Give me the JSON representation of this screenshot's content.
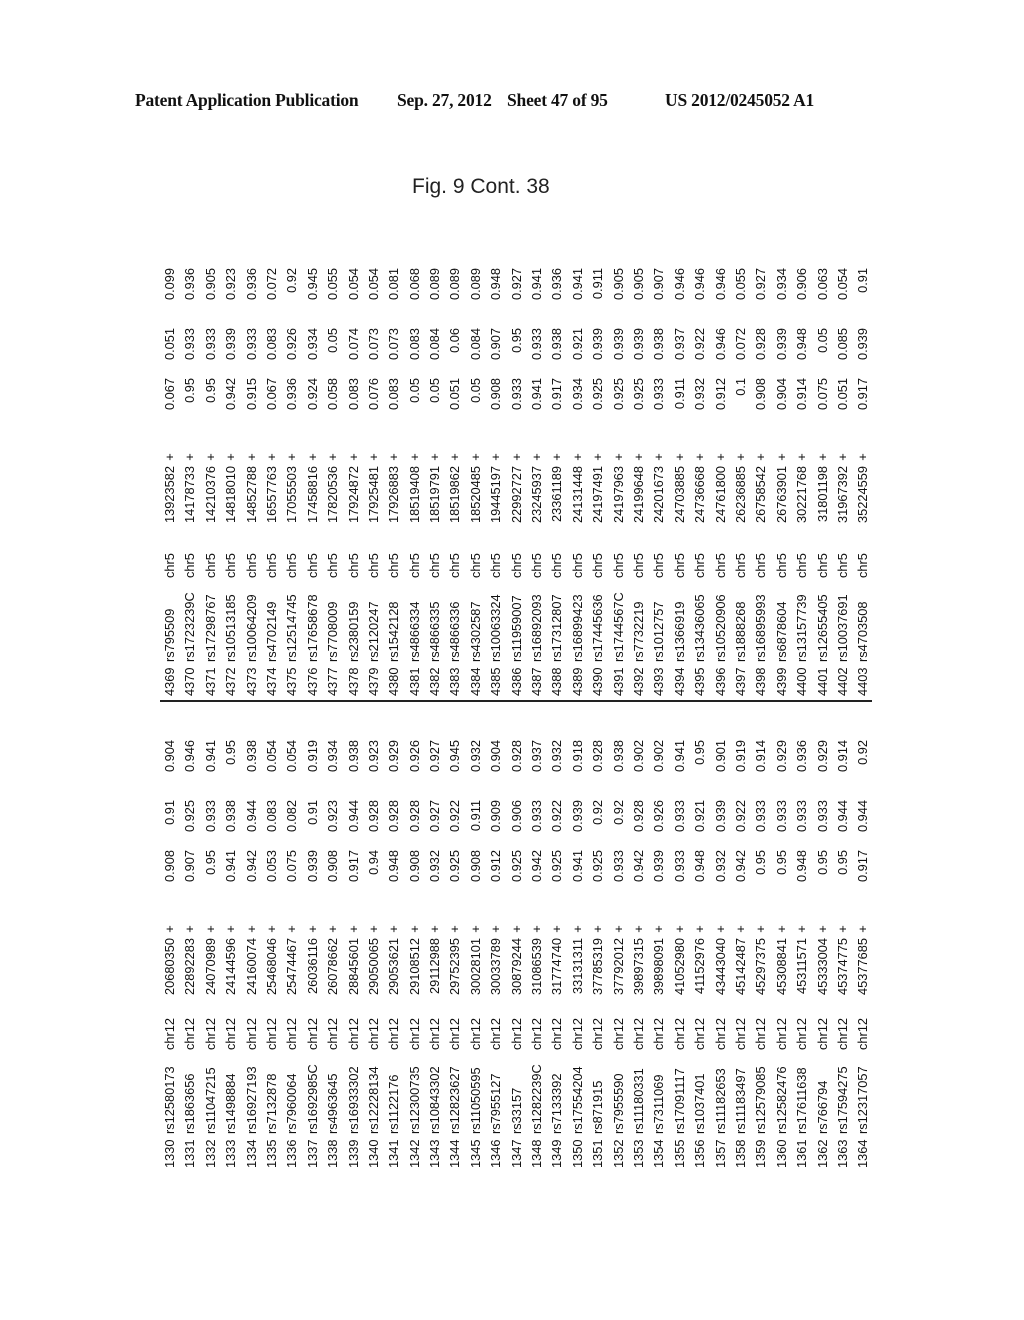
{
  "header": {
    "publication": "Patent Application Publication",
    "date": "Sep. 27, 2012",
    "sheet": "Sheet 47 of 95",
    "number": "US 2012/0245052 A1"
  },
  "figure_label": "Fig. 9   Cont. 38",
  "table_left": [
    [
      "1330",
      "rs12580173",
      "chr12",
      "20680350",
      "+",
      "0.908",
      "0.91",
      "0.904"
    ],
    [
      "1331",
      "rs1863656",
      "chr12",
      "22892283",
      "+",
      "0.907",
      "0.925",
      "0.946"
    ],
    [
      "1332",
      "rs11047215",
      "chr12",
      "24070989",
      "+",
      "0.95",
      "0.933",
      "0.941"
    ],
    [
      "1333",
      "rs1498884",
      "chr12",
      "24144596",
      "+",
      "0.941",
      "0.938",
      "0.95"
    ],
    [
      "1334",
      "rs16927193",
      "chr12",
      "24160074",
      "+",
      "0.942",
      "0.944",
      "0.938"
    ],
    [
      "1335",
      "rs7132878",
      "chr12",
      "25468046",
      "+",
      "0.053",
      "0.083",
      "0.054"
    ],
    [
      "1336",
      "rs7960064",
      "chr12",
      "25474467",
      "+",
      "0.075",
      "0.082",
      "0.054"
    ],
    [
      "1337",
      "rs1692985C",
      "chr12",
      "26036116",
      "+",
      "0.939",
      "0.91",
      "0.919"
    ],
    [
      "1338",
      "rs4963645",
      "chr12",
      "26078662",
      "+",
      "0.908",
      "0.923",
      "0.934"
    ],
    [
      "1339",
      "rs16933302",
      "chr12",
      "28845601",
      "+",
      "0.917",
      "0.944",
      "0.938"
    ],
    [
      "1340",
      "rs12228134",
      "chr12",
      "29050065",
      "+",
      "0.94",
      "0.928",
      "0.923"
    ],
    [
      "1341",
      "rs1122176",
      "chr12",
      "29053621",
      "+",
      "0.948",
      "0.928",
      "0.929"
    ],
    [
      "1342",
      "rs12300735",
      "chr12",
      "29108512",
      "+",
      "0.908",
      "0.928",
      "0.926"
    ],
    [
      "1343",
      "rs10843302",
      "chr12",
      "29112988",
      "+",
      "0.932",
      "0.927",
      "0.927"
    ],
    [
      "1344",
      "rs12823627",
      "chr12",
      "29752395",
      "+",
      "0.925",
      "0.922",
      "0.945"
    ],
    [
      "1345",
      "rs11050595",
      "chr12",
      "30028101",
      "+",
      "0.908",
      "0.911",
      "0.932"
    ],
    [
      "1346",
      "rs7955127",
      "chr12",
      "30033789",
      "+",
      "0.912",
      "0.909",
      "0.904"
    ],
    [
      "1347",
      "rs33157",
      "chr12",
      "30879244",
      "+",
      "0.925",
      "0.906",
      "0.928"
    ],
    [
      "1348",
      "rs1282239C",
      "chr12",
      "31086539",
      "+",
      "0.942",
      "0.933",
      "0.937"
    ],
    [
      "1349",
      "rs7133392",
      "chr12",
      "31774740",
      "+",
      "0.925",
      "0.922",
      "0.932"
    ],
    [
      "1350",
      "rs17554204",
      "chr12",
      "33131311",
      "+",
      "0.941",
      "0.939",
      "0.918"
    ],
    [
      "1351",
      "rs871915",
      "chr12",
      "37785319",
      "+",
      "0.925",
      "0.92",
      "0.928"
    ],
    [
      "1352",
      "rs7955590",
      "chr12",
      "37792012",
      "+",
      "0.933",
      "0.92",
      "0.938"
    ],
    [
      "1353",
      "rs11180331",
      "chr12",
      "39897315",
      "+",
      "0.942",
      "0.928",
      "0.902"
    ],
    [
      "1354",
      "rs7311069",
      "chr12",
      "39898091",
      "+",
      "0.939",
      "0.926",
      "0.902"
    ],
    [
      "1355",
      "rs17091117",
      "chr12",
      "41052980",
      "+",
      "0.933",
      "0.933",
      "0.941"
    ],
    [
      "1356",
      "rs1037401",
      "chr12",
      "41152976",
      "+",
      "0.948",
      "0.921",
      "0.95"
    ],
    [
      "1357",
      "rs11182653",
      "chr12",
      "43443040",
      "+",
      "0.932",
      "0.939",
      "0.901"
    ],
    [
      "1358",
      "rs11183497",
      "chr12",
      "45142487",
      "+",
      "0.942",
      "0.922",
      "0.919"
    ],
    [
      "1359",
      "rs12579085",
      "chr12",
      "45297375",
      "+",
      "0.95",
      "0.933",
      "0.914"
    ],
    [
      "1360",
      "rs12582476",
      "chr12",
      "45308841",
      "+",
      "0.95",
      "0.933",
      "0.929"
    ],
    [
      "1361",
      "rs17611638",
      "chr12",
      "45311571",
      "+",
      "0.948",
      "0.933",
      "0.936"
    ],
    [
      "1362",
      "rs766794",
      "chr12",
      "45333004",
      "+",
      "0.95",
      "0.933",
      "0.929"
    ],
    [
      "1363",
      "rs17594275",
      "chr12",
      "45374775",
      "+",
      "0.95",
      "0.944",
      "0.914"
    ],
    [
      "1364",
      "rs12317057",
      "chr12",
      "45377685",
      "+",
      "0.917",
      "0.944",
      "0.92"
    ]
  ],
  "table_right": [
    [
      "4369",
      "rs795509",
      "chr5",
      "13923582",
      "+",
      "0.067",
      "0.051",
      "0.099"
    ],
    [
      "4370",
      "rs1723239C",
      "chr5",
      "14178733",
      "+",
      "0.95",
      "0.933",
      "0.936"
    ],
    [
      "4371",
      "rs17298767",
      "chr5",
      "14210376",
      "+",
      "0.95",
      "0.933",
      "0.905"
    ],
    [
      "4372",
      "rs10513185",
      "chr5",
      "14818010",
      "+",
      "0.942",
      "0.939",
      "0.923"
    ],
    [
      "4373",
      "rs10064209",
      "chr5",
      "14852788",
      "+",
      "0.915",
      "0.933",
      "0.936"
    ],
    [
      "4374",
      "rs4702149",
      "chr5",
      "16557763",
      "+",
      "0.067",
      "0.083",
      "0.072"
    ],
    [
      "4375",
      "rs12514745",
      "chr5",
      "17055503",
      "+",
      "0.936",
      "0.926",
      "0.92"
    ],
    [
      "4376",
      "rs17658678",
      "chr5",
      "17458816",
      "+",
      "0.924",
      "0.934",
      "0.945"
    ],
    [
      "4377",
      "rs7708009",
      "chr5",
      "17820536",
      "+",
      "0.058",
      "0.05",
      "0.055"
    ],
    [
      "4378",
      "rs2380159",
      "chr5",
      "17924872",
      "+",
      "0.083",
      "0.074",
      "0.054"
    ],
    [
      "4379",
      "rs2120247",
      "chr5",
      "17925481",
      "+",
      "0.076",
      "0.073",
      "0.054"
    ],
    [
      "4380",
      "rs1542128",
      "chr5",
      "17926883",
      "+",
      "0.083",
      "0.073",
      "0.081"
    ],
    [
      "4381",
      "rs4866334",
      "chr5",
      "18519408",
      "+",
      "0.05",
      "0.083",
      "0.068"
    ],
    [
      "4382",
      "rs4866335",
      "chr5",
      "18519791",
      "+",
      "0.05",
      "0.084",
      "0.089"
    ],
    [
      "4383",
      "rs4866336",
      "chr5",
      "18519862",
      "+",
      "0.051",
      "0.06",
      "0.089"
    ],
    [
      "4384",
      "rs4302587",
      "chr5",
      "18520485",
      "+",
      "0.05",
      "0.084",
      "0.089"
    ],
    [
      "4385",
      "rs10063324",
      "chr5",
      "19445197",
      "+",
      "0.908",
      "0.907",
      "0.948"
    ],
    [
      "4386",
      "rs11959007",
      "chr5",
      "22992727",
      "+",
      "0.933",
      "0.95",
      "0.927"
    ],
    [
      "4387",
      "rs16892093",
      "chr5",
      "23245937",
      "+",
      "0.941",
      "0.933",
      "0.941"
    ],
    [
      "4388",
      "rs17312807",
      "chr5",
      "23361189",
      "+",
      "0.917",
      "0.938",
      "0.936"
    ],
    [
      "4389",
      "rs16899423",
      "chr5",
      "24131448",
      "+",
      "0.934",
      "0.921",
      "0.941"
    ],
    [
      "4390",
      "rs17445636",
      "chr5",
      "24197491",
      "+",
      "0.925",
      "0.939",
      "0.911"
    ],
    [
      "4391",
      "rs1744567C",
      "chr5",
      "24197963",
      "+",
      "0.925",
      "0.939",
      "0.905"
    ],
    [
      "4392",
      "rs7732219",
      "chr5",
      "24199648",
      "+",
      "0.925",
      "0.939",
      "0.905"
    ],
    [
      "4393",
      "rs1012757",
      "chr5",
      "24201673",
      "+",
      "0.933",
      "0.938",
      "0.907"
    ],
    [
      "4394",
      "rs1366919",
      "chr5",
      "24703885",
      "+",
      "0.911",
      "0.937",
      "0.946"
    ],
    [
      "4395",
      "rs13436065",
      "chr5",
      "24736668",
      "+",
      "0.932",
      "0.922",
      "0.946"
    ],
    [
      "4396",
      "rs10520906",
      "chr5",
      "24761800",
      "+",
      "0.912",
      "0.946",
      "0.946"
    ],
    [
      "4397",
      "rs1888268",
      "chr5",
      "26236885",
      "+",
      "0.1",
      "0.072",
      "0.055"
    ],
    [
      "4398",
      "rs16895993",
      "chr5",
      "26758542",
      "+",
      "0.908",
      "0.928",
      "0.927"
    ],
    [
      "4399",
      "rs6878604",
      "chr5",
      "26763901",
      "+",
      "0.904",
      "0.939",
      "0.934"
    ],
    [
      "4400",
      "rs13157739",
      "chr5",
      "30221768",
      "+",
      "0.914",
      "0.948",
      "0.906"
    ],
    [
      "4401",
      "rs12655405",
      "chr5",
      "31801198",
      "+",
      "0.075",
      "0.05",
      "0.063"
    ],
    [
      "4402",
      "rs10037691",
      "chr5",
      "31967392",
      "+",
      "0.051",
      "0.085",
      "0.054"
    ],
    [
      "4403",
      "rs4703508",
      "chr5",
      "35224559",
      "+",
      "0.917",
      "0.939",
      "0.91"
    ]
  ]
}
